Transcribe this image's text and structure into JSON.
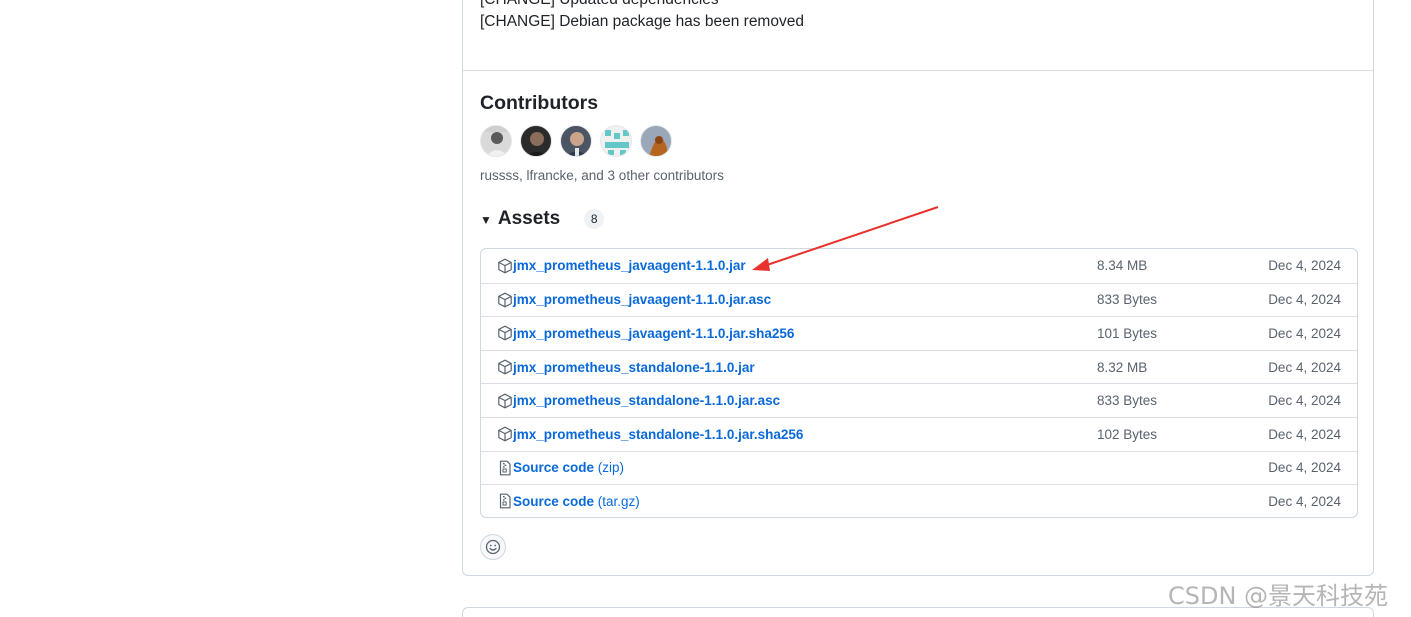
{
  "release": {
    "changelog": [
      "[CHANGE] Updated dependencies",
      "[CHANGE] Debian package has been removed"
    ],
    "contributors_title": "Contributors",
    "contributors_summary": "russss, lfrancke, and 3 other contributors",
    "avatars": [
      {
        "name": "contributor-1"
      },
      {
        "name": "contributor-2"
      },
      {
        "name": "contributor-3"
      },
      {
        "name": "contributor-4"
      },
      {
        "name": "contributor-5"
      }
    ]
  },
  "assets": {
    "title": "Assets",
    "count": "8",
    "items": [
      {
        "name": "jmx_prometheus_javaagent-1.1.0.jar",
        "suffix": "",
        "size": "8.34 MB",
        "date": "Dec 4, 2024",
        "icon": "package-icon"
      },
      {
        "name": "jmx_prometheus_javaagent-1.1.0.jar.asc",
        "suffix": "",
        "size": "833 Bytes",
        "date": "Dec 4, 2024",
        "icon": "package-icon"
      },
      {
        "name": "jmx_prometheus_javaagent-1.1.0.jar.sha256",
        "suffix": "",
        "size": "101 Bytes",
        "date": "Dec 4, 2024",
        "icon": "package-icon"
      },
      {
        "name": "jmx_prometheus_standalone-1.1.0.jar",
        "suffix": "",
        "size": "8.32 MB",
        "date": "Dec 4, 2024",
        "icon": "package-icon"
      },
      {
        "name": "jmx_prometheus_standalone-1.1.0.jar.asc",
        "suffix": "",
        "size": "833 Bytes",
        "date": "Dec 4, 2024",
        "icon": "package-icon"
      },
      {
        "name": "jmx_prometheus_standalone-1.1.0.jar.sha256",
        "suffix": "",
        "size": "102 Bytes",
        "date": "Dec 4, 2024",
        "icon": "package-icon"
      },
      {
        "name": "Source code",
        "suffix": " (zip)",
        "size": "",
        "date": "Dec 4, 2024",
        "icon": "file-zip-icon"
      },
      {
        "name": "Source code",
        "suffix": " (tar.gz)",
        "size": "",
        "date": "Dec 4, 2024",
        "icon": "file-zip-icon"
      }
    ]
  },
  "watermark": "CSDN @景天科技苑",
  "colors": {
    "link": "#0969da",
    "muted": "#59636e",
    "border": "#d0d7de",
    "annotation_arrow": "#e8322b"
  }
}
